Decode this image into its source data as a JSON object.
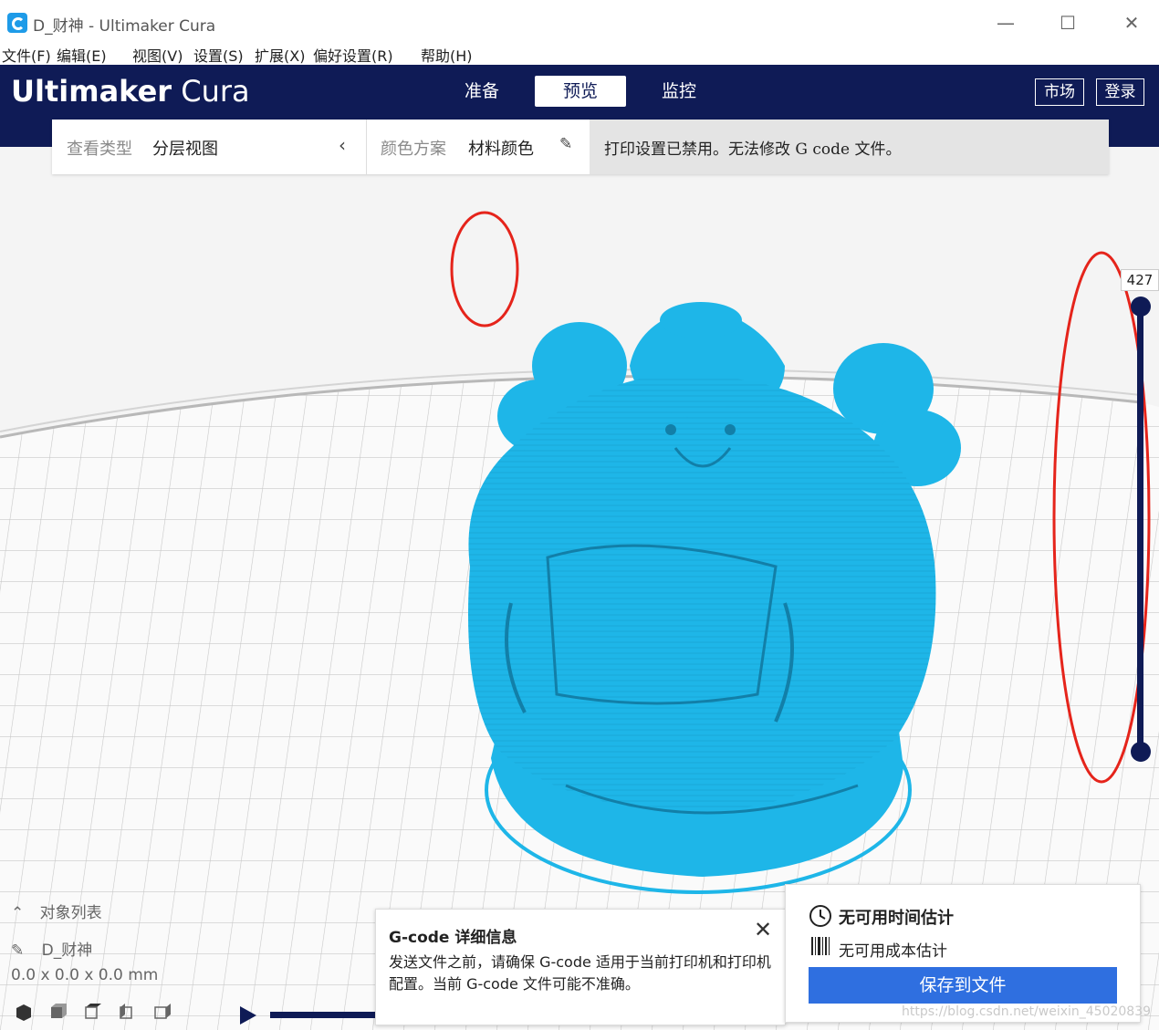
{
  "window": {
    "title": "D_财神 - Ultimaker Cura",
    "minimize_glyph": "—",
    "maximize_glyph": "☐",
    "close_glyph": "✕"
  },
  "menubar": {
    "items": [
      "文件(F)",
      "编辑(E)",
      "视图(V)",
      "设置(S)",
      "扩展(X)",
      "偏好设置(R)",
      "帮助(H)"
    ]
  },
  "header": {
    "brand_bold": "Ultimaker",
    "brand_light": "Cura",
    "tabs": [
      {
        "label": "准备",
        "active": false
      },
      {
        "label": "预览",
        "active": true
      },
      {
        "label": "监控",
        "active": false
      }
    ],
    "market_button": "市场",
    "login_button": "登录"
  },
  "subbar": {
    "view_type_label": "查看类型",
    "view_type_value": "分层视图",
    "color_scheme_label": "颜色方案",
    "color_scheme_value": "材料颜色",
    "message": "打印设置已禁用。无法修改 G code 文件。"
  },
  "layer_slider": {
    "current_layer": "427"
  },
  "object_list": {
    "header": "对象列表",
    "object_name": "D_财神",
    "dimensions": "0.0 x 0.0 x 0.0 mm"
  },
  "gcode_info": {
    "title": "G-code 详细信息",
    "close_glyph": "✕",
    "body": "发送文件之前，请确保 G-code 适用于当前打印机和打印机配置。当前 G-code 文件可能不准确。"
  },
  "estimates": {
    "time": "无可用时间估计",
    "cost": "无可用成本估计",
    "save_button": "保存到文件"
  },
  "watermark": "https://blog.csdn.net/weixin_45020839",
  "colors": {
    "header_bg": "#0F1B56",
    "model": "#1EB6E8",
    "accent_blue": "#2F6FE0",
    "annotation_red": "#E5241B"
  },
  "icons": {
    "logo": "cura-logo-icon",
    "collapse": "chevron-left-icon",
    "edit": "pencil-icon",
    "clock": "clock-icon",
    "barcode": "barcode-icon",
    "play": "play-icon"
  }
}
